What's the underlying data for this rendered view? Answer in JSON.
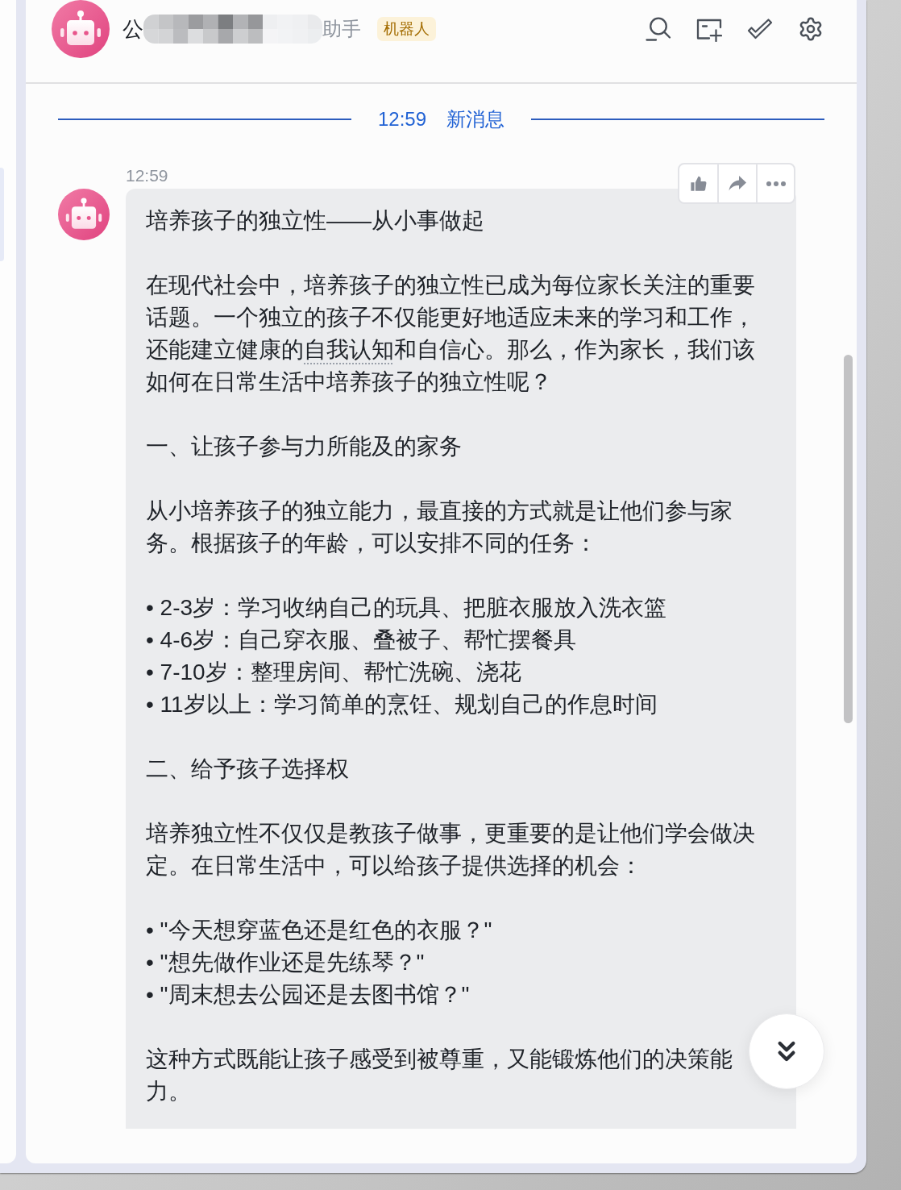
{
  "header": {
    "title_parts": [
      "公",
      "助手"
    ],
    "badge": "机器人"
  },
  "divider": {
    "time": "12:59",
    "label": "新消息"
  },
  "messages": [
    {
      "time": "12:59",
      "blocks": [
        {
          "kind": "paragraph",
          "parts": [
            {
              "kind": "text",
              "text": "培养孩子的独立性——从小事做起"
            }
          ]
        },
        {
          "kind": "paragraph",
          "parts": [
            {
              "kind": "text",
              "text": "在现代社会中，培养孩子的独立性已成为每位家长关注的重要话题。一个独立的孩子不仅能更好地适应未来的学习和工作，还能建立健康的"
            },
            {
              "kind": "term",
              "text": "自我认知"
            },
            {
              "kind": "text",
              "text": "和自信心。那么，作为家长，我们该如何在日常生活中培养孩子的独立性呢？"
            }
          ]
        },
        {
          "kind": "paragraph",
          "parts": [
            {
              "kind": "text",
              "text": "一、让孩子参与力所能及的家务"
            }
          ]
        },
        {
          "kind": "paragraph",
          "parts": [
            {
              "kind": "text",
              "text": "从小培养孩子的独立能力，最直接的方式就是让他们参与家务。根据孩子的年龄，可以安排不同的任务："
            }
          ]
        },
        {
          "kind": "list",
          "items": [
            "• 2-3岁：学习收纳自己的玩具、把脏衣服放入洗衣篮",
            "• 4-6岁：自己穿衣服、叠被子、帮忙摆餐具",
            "• 7-10岁：整理房间、帮忙洗碗、浇花",
            "• 11岁以上：学习简单的烹饪、规划自己的作息时间"
          ]
        },
        {
          "kind": "paragraph",
          "parts": [
            {
              "kind": "text",
              "text": "二、给予孩子选择权"
            }
          ]
        },
        {
          "kind": "paragraph",
          "parts": [
            {
              "kind": "text",
              "text": "培养独立性不仅仅是教孩子做事，更重要的是让他们学会做决定。在日常生活中，可以给孩子提供选择的机会："
            }
          ]
        },
        {
          "kind": "list",
          "items": [
            "• \"今天想穿蓝色还是红色的衣服？\"",
            "• \"想先做作业还是先练琴？\"",
            "• \"周末想去公园还是去图书馆？\""
          ]
        },
        {
          "kind": "paragraph",
          "parts": [
            {
              "kind": "text",
              "text": "这种方式既能让孩子感受到被尊重，又能锻炼他们的决策能力。"
            }
          ]
        }
      ]
    }
  ]
}
